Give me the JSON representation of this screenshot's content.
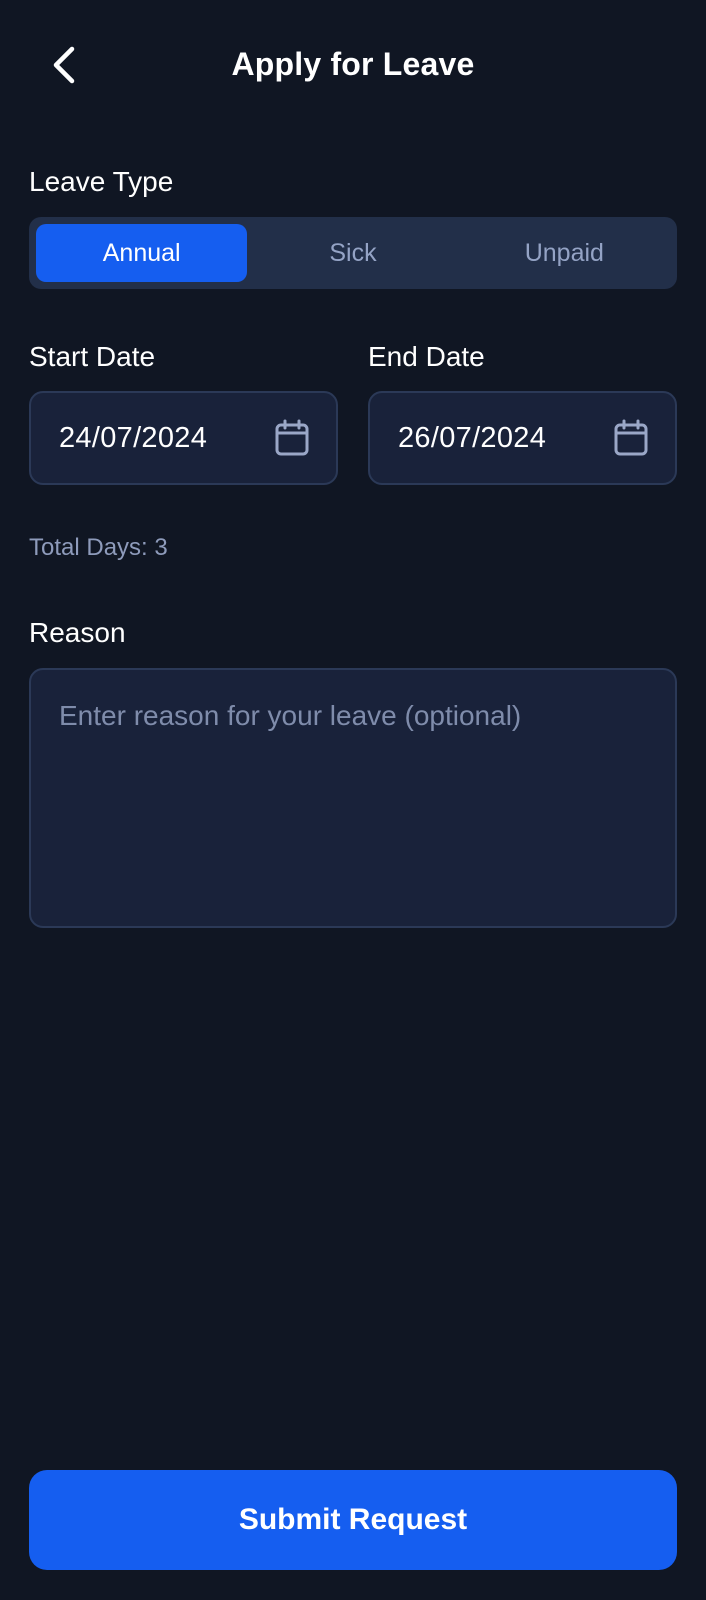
{
  "header": {
    "title": "Apply for Leave",
    "back_icon": "chevron-left-icon"
  },
  "leave_type": {
    "label": "Leave Type",
    "options": [
      "Annual",
      "Sick",
      "Unpaid"
    ],
    "selected": "Annual"
  },
  "start_date": {
    "label": "Start Date",
    "value": "24/07/2024",
    "icon": "calendar-icon"
  },
  "end_date": {
    "label": "End Date",
    "value": "26/07/2024",
    "icon": "calendar-icon"
  },
  "total_days": {
    "text": "Total Days: 3"
  },
  "reason": {
    "label": "Reason",
    "placeholder": "Enter reason for your leave (optional)",
    "value": ""
  },
  "submit": {
    "label": "Submit Request"
  },
  "colors": {
    "background": "#101623",
    "accent": "#155ef0",
    "field_bg": "#19223a",
    "field_border": "#2b3957",
    "segment_bg": "#222f49",
    "muted_text": "#8e9bbb"
  }
}
